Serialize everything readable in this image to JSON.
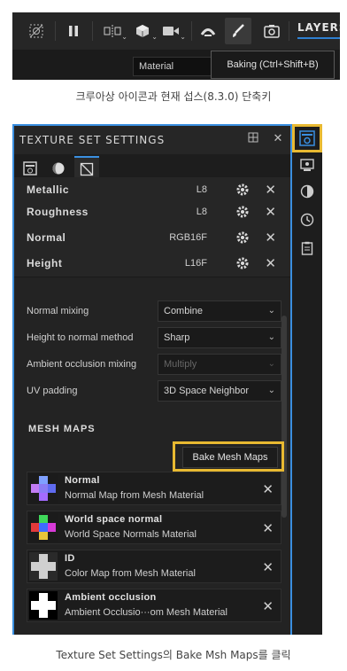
{
  "toolbar": {
    "layers_tab": "LAYERS",
    "material_label": "Material",
    "tooltip": "Baking (Ctrl+Shift+B)",
    "icons": [
      "mask-off-icon",
      "pause-icon",
      "symmetry-icon",
      "cube-view-icon",
      "camera-record-icon",
      "bake-icon",
      "brush-icon",
      "screenshot-icon"
    ]
  },
  "caption_top": "크루아상 아이콘과 현재 섭스(8.3.0) 단축키",
  "caption_bottom": "Texture Set Settings의 Bake Msh Maps를 클릭",
  "panel": {
    "title": "TEXTURE SET SETTINGS",
    "channels": [
      {
        "name": "Metallic",
        "format": "L8"
      },
      {
        "name": "Roughness",
        "format": "L8"
      },
      {
        "name": "Normal",
        "format": "RGB16F"
      },
      {
        "name": "Height",
        "format": "L16F"
      }
    ],
    "settings": [
      {
        "label": "Normal mixing",
        "value": "Combine",
        "disabled": false
      },
      {
        "label": "Height to normal method",
        "value": "Sharp",
        "disabled": false
      },
      {
        "label": "Ambient occlusion mixing",
        "value": "Multiply",
        "disabled": true
      },
      {
        "label": "UV padding",
        "value": "3D Space Neighbor",
        "disabled": false
      }
    ],
    "mesh_maps_title": "MESH MAPS",
    "bake_button": "Bake Mesh Maps",
    "mesh_maps": [
      {
        "name": "Normal",
        "desc": "Normal Map from Mesh Material"
      },
      {
        "name": "World space normal",
        "desc": "World Space Normals Material"
      },
      {
        "name": "ID",
        "desc": "Color Map from Mesh Material"
      },
      {
        "name": "Ambient occlusion",
        "desc": "Ambient Occlusio···om Mesh Material"
      }
    ]
  },
  "colors": {
    "accent": "#3a8fe0",
    "highlight": "#e8b931",
    "panel_bg": "#232323"
  }
}
